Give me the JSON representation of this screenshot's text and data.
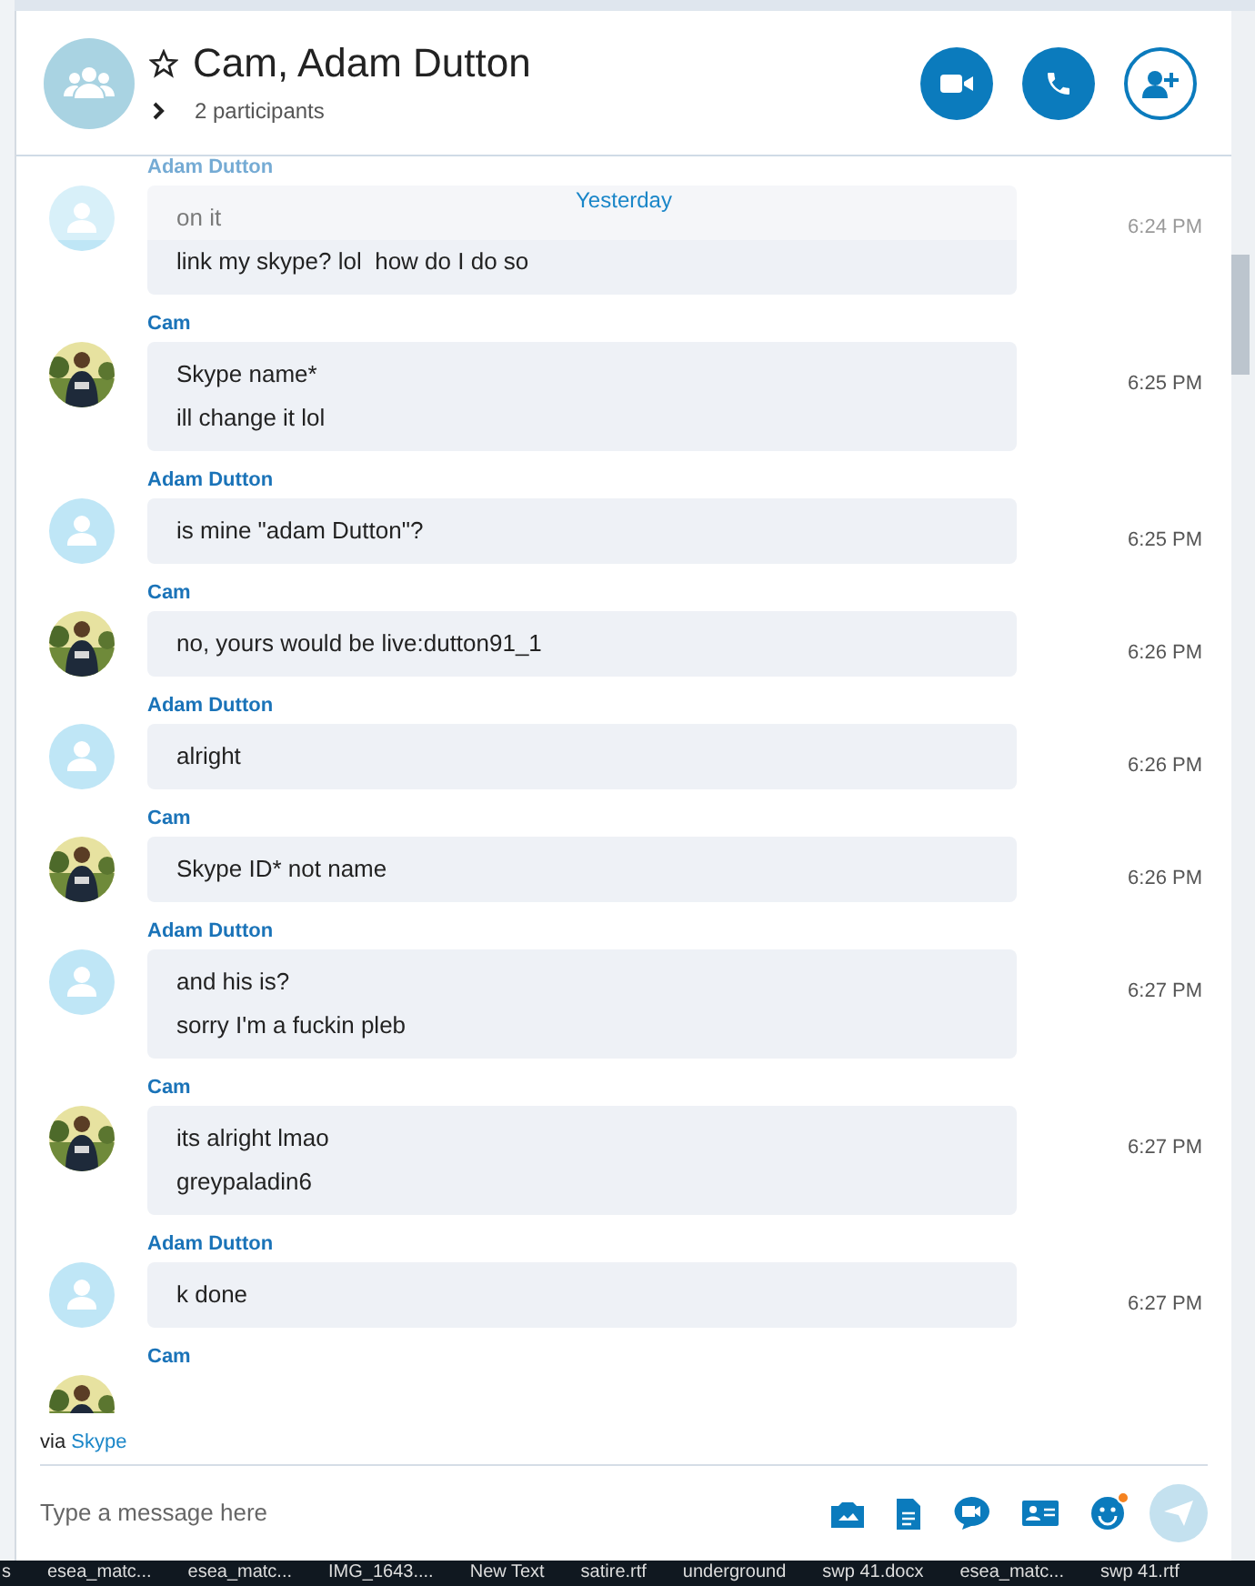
{
  "header": {
    "title": "Cam, Adam Dutton",
    "participants": "2 participants",
    "favorite": false
  },
  "date_divider": "Yesterday",
  "messages": [
    {
      "sender": "Adam Dutton",
      "kind": "default",
      "time": "6:24 PM",
      "lines": [
        "on it",
        "link my skype? lol  how do I do so"
      ]
    },
    {
      "sender": "Cam",
      "time": "6:25 PM",
      "lines": [
        "Skype name*",
        "ill change it lol"
      ]
    },
    {
      "sender": "Adam Dutton",
      "kind": "default",
      "time": "6:25 PM",
      "lines": [
        "is mine \"adam Dutton\"?"
      ]
    },
    {
      "sender": "Cam",
      "time": "6:26 PM",
      "lines": [
        "no, yours would be live:dutton91_1"
      ]
    },
    {
      "sender": "Adam Dutton",
      "kind": "default",
      "time": "6:26 PM",
      "lines": [
        "alright"
      ]
    },
    {
      "sender": "Cam",
      "time": "6:26 PM",
      "lines": [
        "Skype ID* not name"
      ]
    },
    {
      "sender": "Adam Dutton",
      "kind": "default",
      "time": "6:27 PM",
      "lines": [
        "and his is?",
        "sorry I'm a fuckin pleb"
      ]
    },
    {
      "sender": "Cam",
      "time": "6:27 PM",
      "lines": [
        "its alright lmao",
        "greypaladin6"
      ]
    },
    {
      "sender": "Adam Dutton",
      "kind": "default",
      "time": "6:27 PM",
      "lines": [
        "k done"
      ]
    },
    {
      "sender": "Cam"
    }
  ],
  "footer": {
    "via": "via",
    "via_link": "Skype",
    "placeholder": "Type a message here",
    "emoji_notification": true
  },
  "taskbar": [
    "s",
    "esea_matc...",
    "esea_matc...",
    "IMG_1643....",
    "New Text",
    "satire.rtf",
    "underground",
    "swp 41.docx",
    "esea_matc...",
    "swp 41.rtf"
  ]
}
